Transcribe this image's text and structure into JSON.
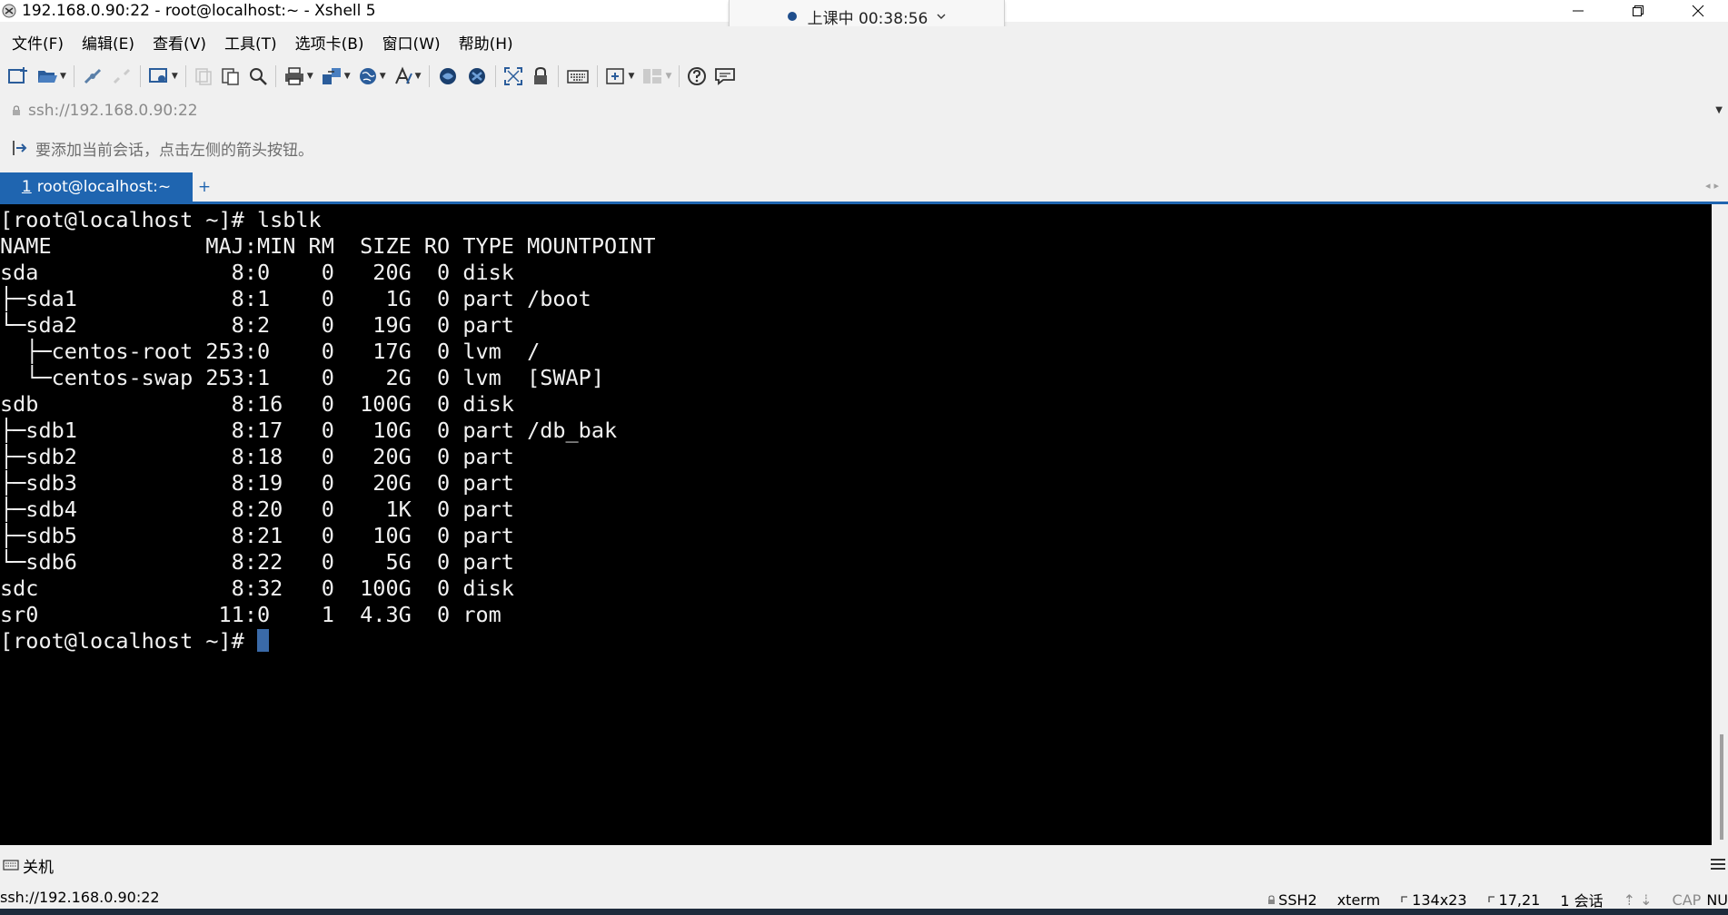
{
  "window": {
    "title": "192.168.0.90:22 - root@localhost:~ - Xshell 5"
  },
  "class_timer": {
    "text": "上课中 00:38:56"
  },
  "menu": {
    "items": [
      "文件(F)",
      "编辑(E)",
      "查看(V)",
      "工具(T)",
      "选项卡(B)",
      "窗口(W)",
      "帮助(H)"
    ]
  },
  "address_bar": {
    "value": "ssh://192.168.0.90:22"
  },
  "hint_bar": {
    "text": "要添加当前会话，点击左侧的箭头按钮。"
  },
  "tabs": {
    "active": {
      "number": "1",
      "label": "root@localhost:~"
    },
    "add_label": "+"
  },
  "terminal": {
    "lines": [
      "[root@localhost ~]# lsblk",
      "NAME            MAJ:MIN RM  SIZE RO TYPE MOUNTPOINT",
      "sda               8:0    0   20G  0 disk ",
      "├─sda1            8:1    0    1G  0 part /boot",
      "└─sda2            8:2    0   19G  0 part ",
      "  ├─centos-root 253:0    0   17G  0 lvm  /",
      "  └─centos-swap 253:1    0    2G  0 lvm  [SWAP]",
      "sdb               8:16   0  100G  0 disk ",
      "├─sdb1            8:17   0   10G  0 part /db_bak",
      "├─sdb2            8:18   0   20G  0 part ",
      "├─sdb3            8:19   0   20G  0 part ",
      "├─sdb4            8:20   0    1K  0 part ",
      "├─sdb5            8:21   0   10G  0 part ",
      "└─sdb6            8:22   0    5G  0 part ",
      "sdc               8:32   0  100G  0 disk ",
      "sr0              11:0    1  4.3G  0 rom  "
    ],
    "prompt": "[root@localhost ~]# "
  },
  "command_bar": {
    "label": "关机"
  },
  "status_bar": {
    "address": "ssh://192.168.0.90:22",
    "protocol": "SSH2",
    "terminal_type": "xterm",
    "size": "134x23",
    "cursor_pos": "17,21",
    "sessions": "1 会话",
    "caps": "CAP",
    "num": "NU"
  },
  "colors": {
    "accent": "#1f65b0",
    "terminal_bg": "#000000",
    "terminal_fg": "#f2f2f2",
    "cursor": "#3a6aa8"
  }
}
